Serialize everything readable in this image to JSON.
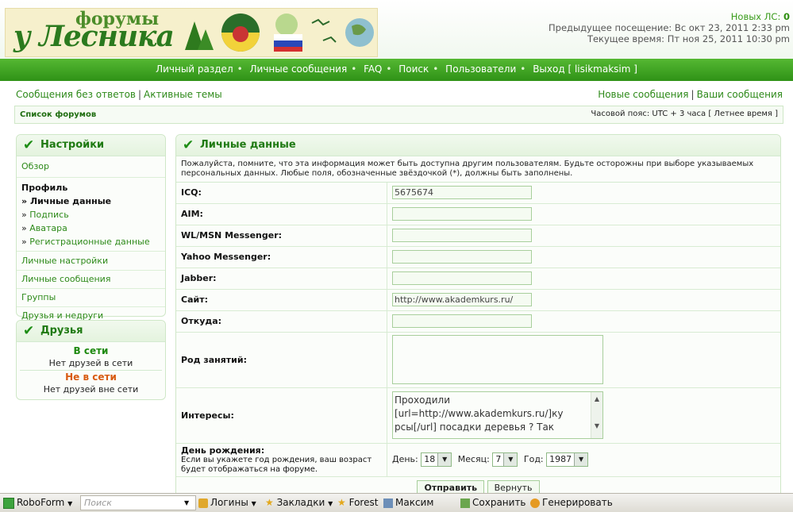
{
  "header": {
    "logo_small": "форумы",
    "logo_big": "у Лесника",
    "new_pm_label": "Новых ЛС:",
    "new_pm_count": "0",
    "last_visit": "Предыдущее посещение: Вс окт 23, 2011 2:33 pm",
    "current_time": "Текущее время: Пт ноя 25, 2011 10:30 pm"
  },
  "nav": {
    "items": [
      "Личный раздел",
      "Личные сообщения",
      "FAQ",
      "Поиск",
      "Пользователи",
      "Выход [ lisikmaksim ]"
    ],
    "sep": "•"
  },
  "links_bar": {
    "left": [
      "Сообщения без ответов",
      "Активные темы"
    ],
    "right": [
      "Новые сообщения",
      "Ваши сообщения"
    ],
    "sep": "|"
  },
  "crumb": {
    "forum_index": "Список форумов",
    "timezone": "Часовой пояс: UTC + 3 часа [ Летнее время ]"
  },
  "settings": {
    "title": "Настройки",
    "overview": "Обзор",
    "profile_heading": "Профиль",
    "profile_items": [
      "Личные данные",
      "Подпись",
      "Аватара",
      "Регистрационные данные"
    ],
    "marker": "»",
    "sections": [
      "Личные настройки",
      "Личные сообщения",
      "Группы",
      "Друзья и недруги"
    ]
  },
  "friends": {
    "title": "Друзья",
    "online_label": "В сети",
    "online_none": "Нет друзей в сети",
    "offline_label": "Не в сети",
    "offline_none": "Нет друзей вне сети"
  },
  "main": {
    "title": "Личные данные",
    "intro": "Пожалуйста, помните, что эта информация может быть доступна другим пользователям. Будьте осторожны при выборе указываемых персональных данных. Любые поля, обозначенные звёздочкой (*), должны быть заполнены.",
    "fields": {
      "icq": {
        "label": "ICQ:",
        "value": "5675674"
      },
      "aim": {
        "label": "AIM:",
        "value": ""
      },
      "msn": {
        "label": "WL/MSN Messenger:",
        "value": ""
      },
      "yahoo": {
        "label": "Yahoo Messenger:",
        "value": ""
      },
      "jabber": {
        "label": "Jabber:",
        "value": ""
      },
      "site": {
        "label": "Сайт:",
        "value": "http://www.akademkurs.ru/"
      },
      "location": {
        "label": "Откуда:",
        "value": ""
      },
      "occupation": {
        "label": "Род занятий:",
        "value": ""
      },
      "interests": {
        "label": "Интересы:",
        "lines": [
          "Проходили",
          "[url=http://www.akademkurs.ru/]ку",
          "рсы[/url] посадки деревья ? Так"
        ]
      }
    },
    "birthday": {
      "label": "День рождения:",
      "hint": "Если вы укажете год рождения, ваш возраст будет отображаться на форуме.",
      "day_label": "День:",
      "day": "18",
      "month_label": "Месяц:",
      "month": "7",
      "year_label": "Год:",
      "year": "1987"
    },
    "submit": "Отправить",
    "reset": "Вернуть"
  },
  "taskbar": {
    "roboform": "RoboForm",
    "search_placeholder": "Поиск",
    "logins": "Логины",
    "bookmarks": "Закладки",
    "forest": "Forest",
    "maksim": "Максим",
    "save": "Сохранить",
    "generate": "Генерировать"
  },
  "colors": {
    "accent": "#2f9217",
    "link": "#2e8a1a",
    "offline": "#d85a10"
  }
}
